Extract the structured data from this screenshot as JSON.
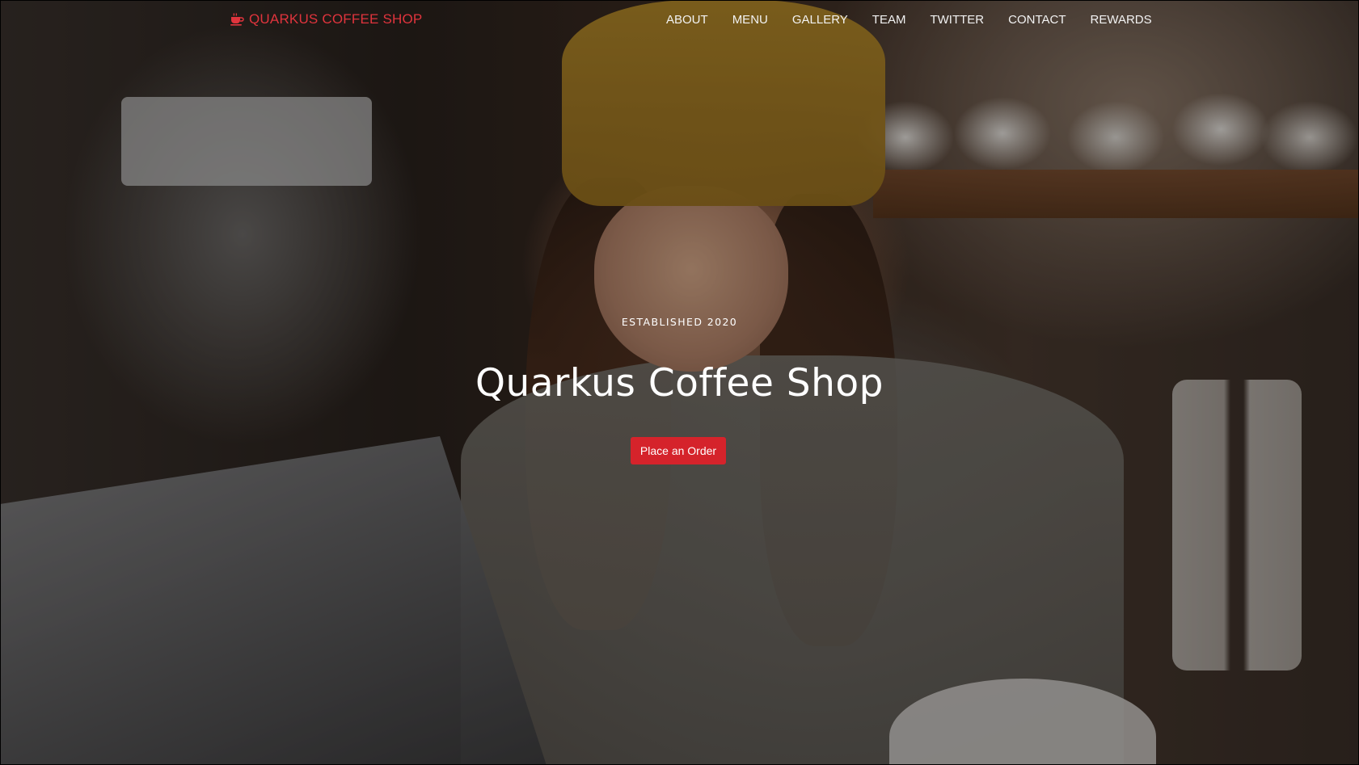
{
  "brand": {
    "icon": "coffee-cup-icon",
    "label": "QUARKUS COFFEE SHOP",
    "color": "#e0343d"
  },
  "nav": {
    "items": [
      {
        "label": "ABOUT"
      },
      {
        "label": "MENU"
      },
      {
        "label": "GALLERY"
      },
      {
        "label": "TEAM"
      },
      {
        "label": "TWITTER"
      },
      {
        "label": "CONTACT"
      },
      {
        "label": "REWARDS"
      }
    ]
  },
  "hero": {
    "eyebrow": "ESTABLISHED 2020",
    "title": "Quarkus Coffee Shop",
    "cta_label": "Place an Order",
    "cta_color": "#d5232b",
    "background": "photo-barista-pouring-coffee"
  }
}
